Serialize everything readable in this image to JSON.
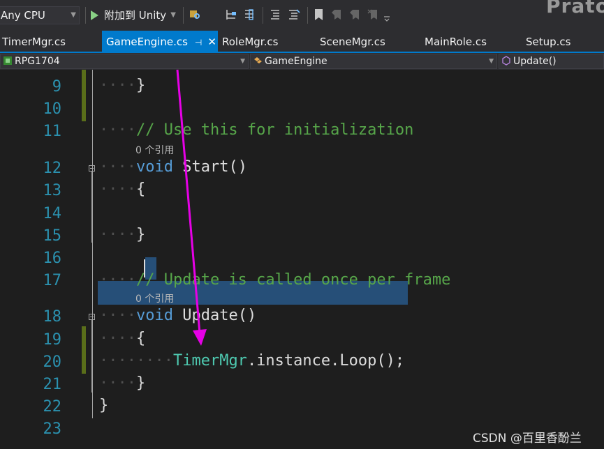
{
  "toolbar": {
    "cpu": "Any CPU",
    "attach": "附加到 Unity",
    "brand": "Prato"
  },
  "tabs": [
    {
      "label": "TimerMgr.cs"
    },
    {
      "label": "GameEngine.cs",
      "active": true
    },
    {
      "label": "RoleMgr.cs"
    },
    {
      "label": "SceneMgr.cs"
    },
    {
      "label": "MainRole.cs"
    },
    {
      "label": "Setup.cs"
    }
  ],
  "navbar": {
    "project": "RPG1704",
    "class": "GameEngine",
    "member": "Update()"
  },
  "editor": {
    "lines": [
      {
        "num": "9",
        "code": "}"
      },
      {
        "num": "10",
        "code": ""
      },
      {
        "num": "11",
        "comment": "// Use this for initialization"
      },
      {
        "num": "12",
        "keyword": "void",
        "name": "Start",
        "paren": "()"
      },
      {
        "num": "13",
        "code": "{"
      },
      {
        "num": "14",
        "code": ""
      },
      {
        "num": "15",
        "code": "}"
      },
      {
        "num": "16",
        "code": ""
      },
      {
        "num": "17",
        "comment": "// Update is called once per frame"
      },
      {
        "num": "18",
        "keyword": "void",
        "name": "Update",
        "paren": "()"
      },
      {
        "num": "19",
        "code": "{"
      },
      {
        "num": "20",
        "type": "TimerMgr",
        "rest": ".instance.Loop();"
      },
      {
        "num": "21",
        "code": "}"
      },
      {
        "num": "22",
        "code": "}"
      },
      {
        "num": "23",
        "code": ""
      }
    ],
    "codelens_start": "0 个引用",
    "codelens_update": "0 个引用",
    "dots4": "····",
    "dots8": "········"
  },
  "watermark": "CSDN @百里香酚兰",
  "colors": {
    "background": "#1e1e1e",
    "accent": "#007acc",
    "keyword": "#569cd6",
    "comment": "#57a64a",
    "type": "#4ec9b0",
    "line_number": "#2b91af",
    "selection": "#264f78",
    "arrow": "#e600e6"
  }
}
